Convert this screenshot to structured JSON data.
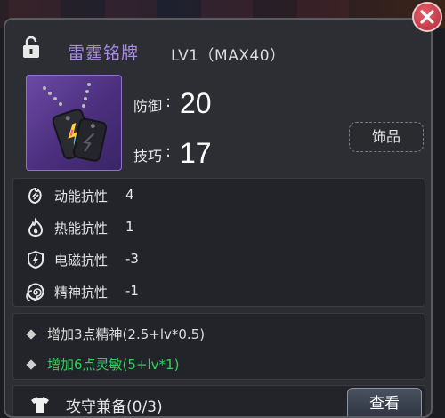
{
  "item": {
    "name": "雷霆铭牌",
    "level": "LV1（MAX40）",
    "type_label": "饰品",
    "image_icon": "dog-tag-icon"
  },
  "stats": [
    {
      "label": "防御",
      "colon": ":",
      "value": "20"
    },
    {
      "label": "技巧",
      "colon": ":",
      "value": "17"
    }
  ],
  "resistances": [
    {
      "icon": "kinetic-icon",
      "label": "动能抗性",
      "value": "4"
    },
    {
      "icon": "thermal-icon",
      "label": "热能抗性",
      "value": "1"
    },
    {
      "icon": "electromagnetic-icon",
      "label": "电磁抗性",
      "value": "-3"
    },
    {
      "icon": "mental-icon",
      "label": "精神抗性",
      "value": "-1"
    }
  ],
  "bonuses": [
    {
      "text": "增加3点精神(2.5+lv*0.5)",
      "color": "#dcdcdc"
    },
    {
      "text": "增加6点灵敏(5+lv*1)",
      "color": "#2fd15a"
    }
  ],
  "set": {
    "label": "攻守兼备(0/3)",
    "button_label": "查看",
    "icon": "shirt-icon"
  },
  "colors": {
    "name": "#a98be6",
    "rare_frame": "#6b4aa5",
    "close": "#c93a46"
  }
}
